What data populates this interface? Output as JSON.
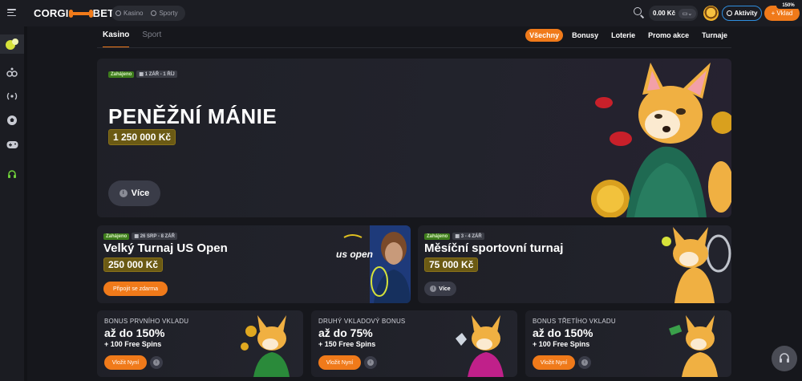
{
  "header": {
    "logo_left": "CORGI",
    "logo_right": "BET",
    "mode_casino": "Kasino",
    "mode_sport": "Sporty",
    "balance": "0.00 Kč",
    "balance_currency": "",
    "activities_label": "Aktivity",
    "deposit_label": "Vklad",
    "deposit_badge": "150%"
  },
  "sidebar": {
    "items": [
      {
        "icon": "tennis-ball-icon",
        "active": true
      },
      {
        "icon": "sports-icon"
      },
      {
        "icon": "live-icon"
      },
      {
        "icon": "football-icon"
      },
      {
        "icon": "gamepad-icon"
      },
      {
        "icon": "headset-icon"
      }
    ]
  },
  "tabs": {
    "casino": "Kasino",
    "sport": "Sport"
  },
  "filters": [
    "Všechny",
    "Bonusy",
    "Loterie",
    "Promo akce",
    "Turnaje"
  ],
  "hero": {
    "status": "Zahájeno",
    "dates": "1 ZÁŘ - 1 ŘÍJ",
    "title": "PENĚŽNÍ MÁNIE",
    "prize": "1 250 000 Kč",
    "more": "Více"
  },
  "promo1": {
    "status": "Zahájeno",
    "dates": "26 SRP - 8 ZÁŘ",
    "title": "Velký Turnaj US Open",
    "prize": "250 000 Kč",
    "button": "Připojit se zdarma",
    "brand": "us open"
  },
  "promo2": {
    "status": "Zahájeno",
    "dates": "3 - 4 ZÁŘ",
    "title": "Měsíční sportovní turnaj",
    "prize": "75 000 Kč",
    "button": "Více"
  },
  "bonuses": [
    {
      "title": "BONUS PRVNÍHO VKLADU",
      "big": "až do 150%",
      "spins": "+ 100 Free Spins",
      "button": "Vložit Nyní"
    },
    {
      "title": "DRUHÝ VKLADOVÝ BONUS",
      "big": "až do 75%",
      "spins": "+ 150 Free Spins",
      "button": "Vložit Nyní"
    },
    {
      "title": "BONUS TŘETÍHO VKLADU",
      "big": "až do 150%",
      "spins": "+ 100 Free Spins",
      "button": "Vložit Nyní"
    }
  ],
  "colors": {
    "accent": "#f07a1a",
    "background": "#16171c",
    "card": "#1f2027",
    "status_green": "#3e7d1c",
    "prize_gold": "#6b5a14"
  }
}
